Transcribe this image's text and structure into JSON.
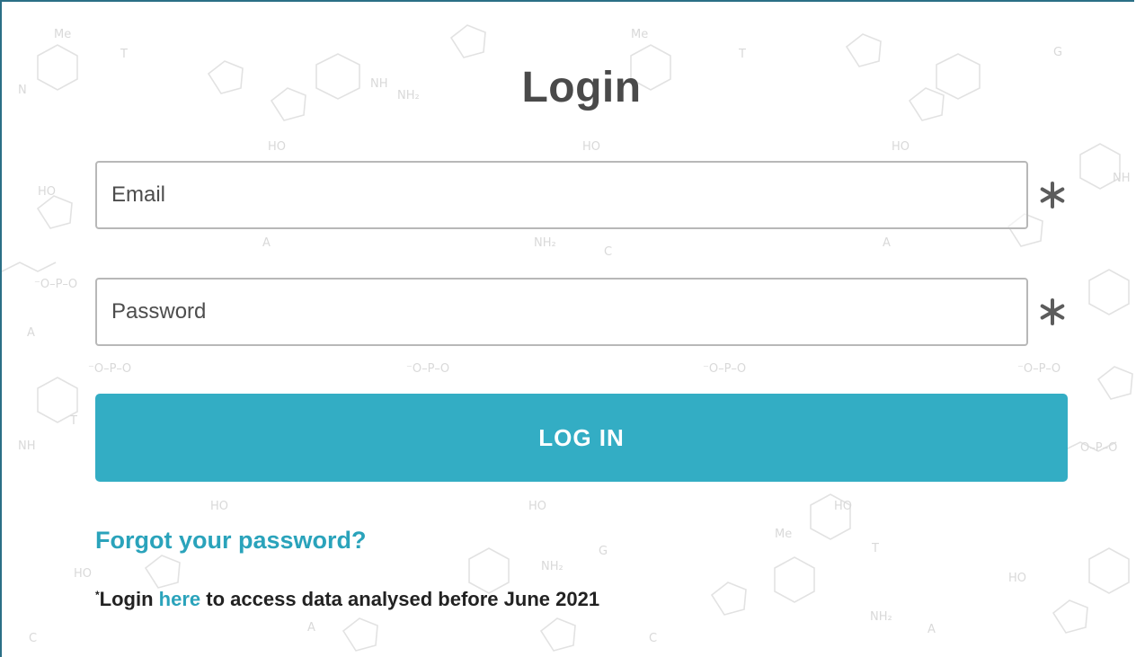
{
  "page": {
    "title": "Login"
  },
  "form": {
    "email_placeholder": "Email",
    "password_placeholder": "Password",
    "required_marker": "*",
    "submit_label": "LOG IN",
    "forgot_password_label": "Forgot your password?"
  },
  "footer_note": {
    "marker": "*",
    "prefix": "Login",
    "link_text": "here",
    "suffix": "to access data analysed before June 2021"
  },
  "colors": {
    "accent": "#33adc4",
    "link": "#2aa3bb",
    "title": "#4a4a4a",
    "frame_border": "#2b6f86"
  },
  "icons": {
    "required": "asterisk-icon",
    "background": "dna-nucleotide-pattern"
  }
}
